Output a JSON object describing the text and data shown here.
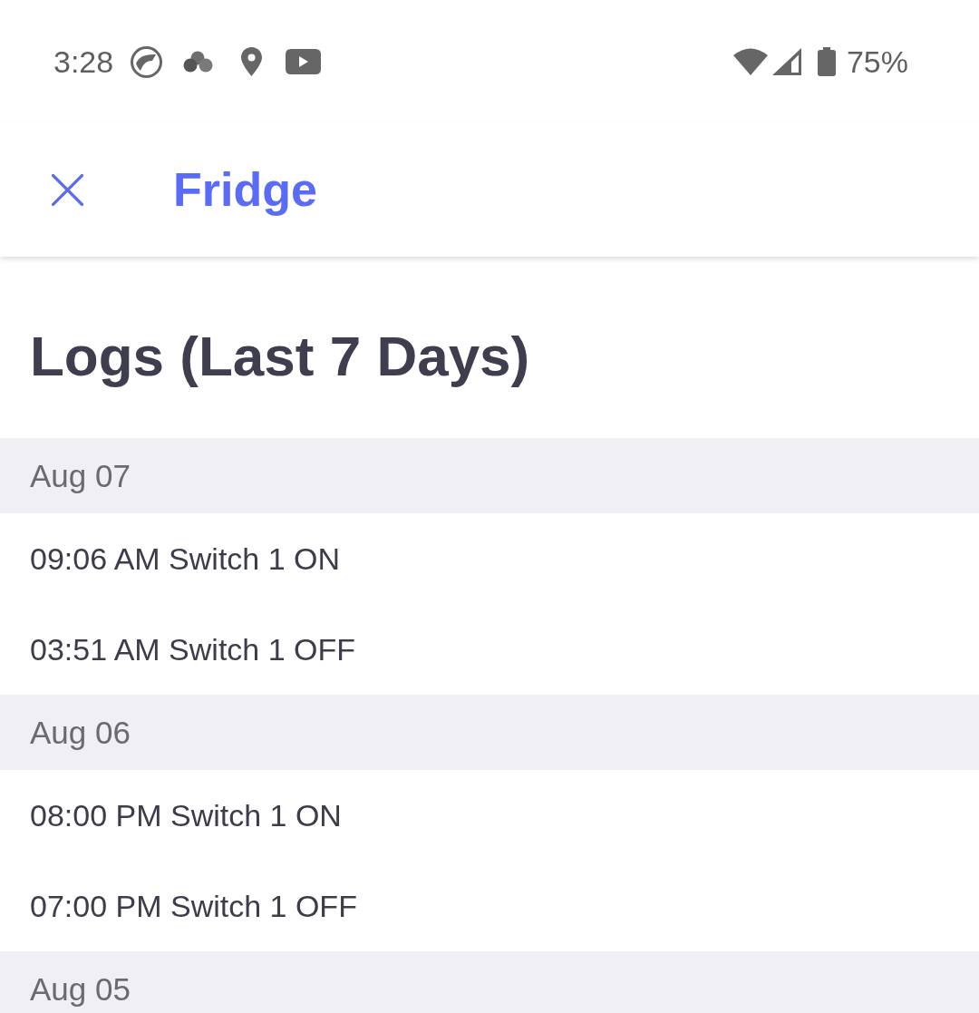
{
  "status_bar": {
    "time": "3:28",
    "battery": "75%"
  },
  "app_bar": {
    "title": "Fridge"
  },
  "page_title": "Logs (Last 7 Days)",
  "sections": [
    {
      "date": "Aug 07",
      "entries": [
        "09:06 AM Switch 1 ON",
        "03:51 AM Switch 1 OFF"
      ]
    },
    {
      "date": "Aug 06",
      "entries": [
        "08:00 PM Switch 1 ON",
        "07:00 PM Switch 1 OFF"
      ]
    },
    {
      "date": "Aug 05"
    }
  ]
}
